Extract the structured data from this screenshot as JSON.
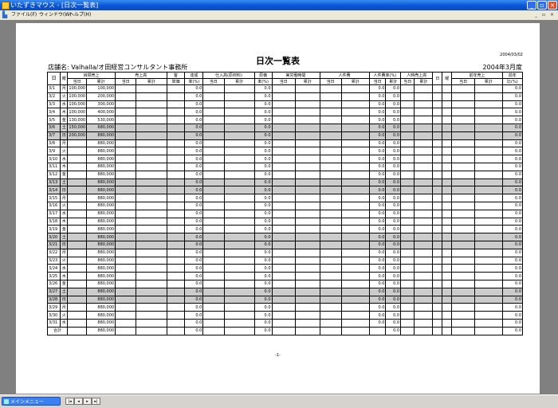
{
  "window": {
    "title": "いたずきマウス - [日次一覧表]",
    "minimize": "_",
    "restore": "▫",
    "close": "×"
  },
  "menu": {
    "items": [
      "ファイル(F)",
      "ウィンドウ(W)",
      "ヘルプ(H)"
    ],
    "mdi": "_ ▫ ×"
  },
  "report": {
    "title": "日次一覧表",
    "date": "2004/03/02",
    "month": "2004年3月度",
    "store": "店舗名:  Valhalla/オ田経営コンサルタント事務所",
    "page": "-1-",
    "header1": [
      "日",
      "曜",
      "目標売上",
      "売上高",
      "客",
      "達成",
      "仕入高(原材料)",
      "原価",
      "実労働時間",
      "人件費",
      "人件費率(%)",
      "人時売上高",
      "日",
      "曜",
      "前年売上",
      "前年"
    ],
    "header2": [
      "当日",
      "累計",
      "当日",
      "累計",
      "単価",
      "率(%)",
      "当日",
      "累計",
      "率(%)",
      "当日",
      "累計",
      "当日",
      "累計",
      "当日",
      "累計",
      "当日",
      "累計",
      "当日",
      "累計",
      "比(%)"
    ],
    "total_label": "合計",
    "total_cum": "880,000",
    "total_values": [
      "0.0",
      "0.0",
      "0.0",
      "0.0",
      "0.0"
    ],
    "rows": [
      {
        "d": "3/1",
        "w": "月",
        "t": "100,000",
        "c": "100,000",
        "we": false
      },
      {
        "d": "3/2",
        "w": "火",
        "t": "100,000",
        "c": "200,000",
        "we": false
      },
      {
        "d": "3/3",
        "w": "水",
        "t": "100,000",
        "c": "300,000",
        "we": false
      },
      {
        "d": "3/4",
        "w": "木",
        "t": "100,000",
        "c": "400,000",
        "we": false
      },
      {
        "d": "3/5",
        "w": "金",
        "t": "130,000",
        "c": "530,000",
        "we": false
      },
      {
        "d": "3/6",
        "w": "土",
        "t": "150,000",
        "c": "680,000",
        "we": true
      },
      {
        "d": "3/7",
        "w": "日",
        "t": "200,000",
        "c": "880,000",
        "we": true
      },
      {
        "d": "3/8",
        "w": "月",
        "t": "",
        "c": "880,000",
        "we": false
      },
      {
        "d": "3/9",
        "w": "火",
        "t": "",
        "c": "880,000",
        "we": false
      },
      {
        "d": "3/10",
        "w": "水",
        "t": "",
        "c": "880,000",
        "we": false
      },
      {
        "d": "3/11",
        "w": "木",
        "t": "",
        "c": "880,000",
        "we": false
      },
      {
        "d": "3/12",
        "w": "金",
        "t": "",
        "c": "880,000",
        "we": false
      },
      {
        "d": "3/13",
        "w": "土",
        "t": "",
        "c": "880,000",
        "we": true
      },
      {
        "d": "3/14",
        "w": "日",
        "t": "",
        "c": "880,000",
        "we": true
      },
      {
        "d": "3/15",
        "w": "月",
        "t": "",
        "c": "880,000",
        "we": false
      },
      {
        "d": "3/16",
        "w": "火",
        "t": "",
        "c": "880,000",
        "we": false
      },
      {
        "d": "3/17",
        "w": "水",
        "t": "",
        "c": "880,000",
        "we": false
      },
      {
        "d": "3/18",
        "w": "木",
        "t": "",
        "c": "880,000",
        "we": false
      },
      {
        "d": "3/19",
        "w": "金",
        "t": "",
        "c": "880,000",
        "we": false
      },
      {
        "d": "3/20",
        "w": "土",
        "t": "",
        "c": "880,000",
        "we": true
      },
      {
        "d": "3/21",
        "w": "日",
        "t": "",
        "c": "880,000",
        "we": true
      },
      {
        "d": "3/22",
        "w": "月",
        "t": "",
        "c": "880,000",
        "we": false
      },
      {
        "d": "3/23",
        "w": "火",
        "t": "",
        "c": "880,000",
        "we": false
      },
      {
        "d": "3/24",
        "w": "水",
        "t": "",
        "c": "880,000",
        "we": false
      },
      {
        "d": "3/25",
        "w": "木",
        "t": "",
        "c": "880,000",
        "we": false
      },
      {
        "d": "3/26",
        "w": "金",
        "t": "",
        "c": "880,000",
        "we": false
      },
      {
        "d": "3/27",
        "w": "土",
        "t": "",
        "c": "880,000",
        "we": true
      },
      {
        "d": "3/28",
        "w": "日",
        "t": "",
        "c": "880,000",
        "we": true
      },
      {
        "d": "3/29",
        "w": "月",
        "t": "",
        "c": "880,000",
        "we": false
      },
      {
        "d": "3/30",
        "w": "火",
        "t": "",
        "c": "880,000",
        "we": false
      },
      {
        "d": "3/31",
        "w": "水",
        "t": "",
        "c": "880,000",
        "we": false
      }
    ],
    "zero": "0.0"
  },
  "taskbar": {
    "button": "メインメニュー",
    "nav": [
      "|◂",
      "◂",
      "▸",
      "▸|"
    ]
  }
}
